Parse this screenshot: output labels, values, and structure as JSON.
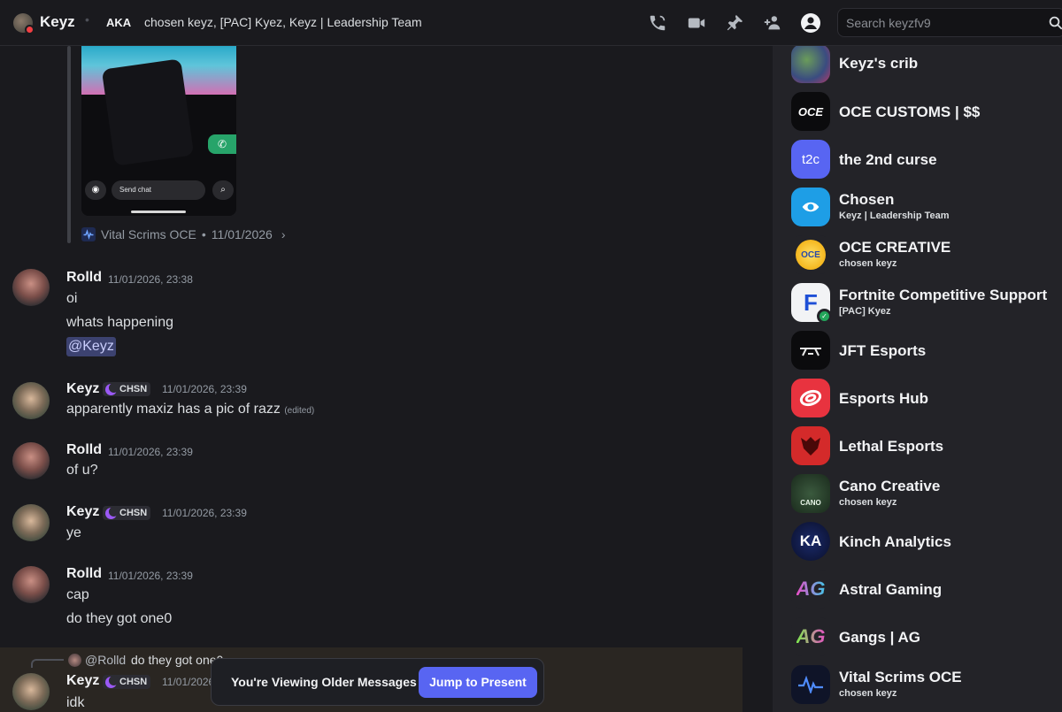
{
  "header": {
    "user_name": "Keyz",
    "aka_label": "AKA",
    "aka_names": "chosen keyz, [PAC] Kyez, Keyz | Leadership Team",
    "search_placeholder": "Search keyzfv9"
  },
  "embed": {
    "source": "Vital Scrims OCE",
    "date": "11/01/2026",
    "send_chat_text": "Send chat"
  },
  "messages": [
    {
      "author": "Rolld",
      "timestamp": "11/01/2026, 23:38",
      "lines": [
        "oi",
        "whats happening"
      ],
      "mention": "@Keyz"
    },
    {
      "author": "Keyz",
      "tag": "CHSN",
      "timestamp": "11/01/2026, 23:39",
      "lines": [
        "apparently maxiz has a pic of razz"
      ],
      "edited": "(edited)"
    },
    {
      "author": "Rolld",
      "timestamp": "11/01/2026, 23:39",
      "lines": [
        "of u?"
      ]
    },
    {
      "author": "Keyz",
      "tag": "CHSN",
      "timestamp": "11/01/2026, 23:39",
      "lines": [
        "ye"
      ]
    },
    {
      "author": "Rolld",
      "timestamp": "11/01/2026, 23:39",
      "lines": [
        "cap",
        "do they got one0"
      ]
    },
    {
      "author": "Keyz",
      "tag": "CHSN",
      "timestamp": "11/01/2026, 23:39",
      "lines": [
        "idk"
      ],
      "reply_to": {
        "author": "@Rolld",
        "text": "do they got one0"
      }
    }
  ],
  "older_banner": {
    "text": "You're Viewing Older Messages",
    "button": "Jump to Present"
  },
  "servers": [
    {
      "name": "Keyz's crib",
      "sub": "",
      "icon": "keyz-crib-icon",
      "icon_text": ""
    },
    {
      "name": "OCE CUSTOMS | $$",
      "sub": "",
      "icon": "oce-customs-icon",
      "icon_text": "OCE"
    },
    {
      "name": "the 2nd curse",
      "sub": "",
      "icon": "t2c-icon",
      "icon_text": "t2c"
    },
    {
      "name": "Chosen",
      "sub": "Keyz | Leadership Team",
      "icon": "chosen-icon",
      "icon_text": ""
    },
    {
      "name": "OCE CREATIVE",
      "sub": "chosen keyz",
      "icon": "oce-creative-icon",
      "icon_text": "OCE"
    },
    {
      "name": "Fortnite Competitive Support",
      "sub": "[PAC] Kyez",
      "icon": "fortnite-support-icon",
      "icon_text": "F"
    },
    {
      "name": "JFT Esports",
      "sub": "",
      "icon": "jft-icon",
      "icon_text": ""
    },
    {
      "name": "Esports Hub",
      "sub": "",
      "icon": "esports-hub-icon",
      "icon_text": ""
    },
    {
      "name": "Lethal Esports",
      "sub": "",
      "icon": "lethal-icon",
      "icon_text": ""
    },
    {
      "name": "Cano Creative",
      "sub": "chosen keyz",
      "icon": "cano-icon",
      "icon_text": "CANO"
    },
    {
      "name": "Kinch Analytics",
      "sub": "",
      "icon": "kinch-icon",
      "icon_text": "KA"
    },
    {
      "name": "Astral Gaming",
      "sub": "",
      "icon": "astral-icon",
      "icon_text": "AG"
    },
    {
      "name": "Gangs | AG",
      "sub": "",
      "icon": "gangs-icon",
      "icon_text": "AG"
    },
    {
      "name": "Vital Scrims OCE",
      "sub": "chosen keyz",
      "icon": "vital-icon",
      "icon_text": ""
    }
  ],
  "colors": {
    "accent": "#5865f2",
    "mention_bg": "#3c4270",
    "status_dnd": "#f23f43",
    "tag_icon": "#9b59f6"
  }
}
